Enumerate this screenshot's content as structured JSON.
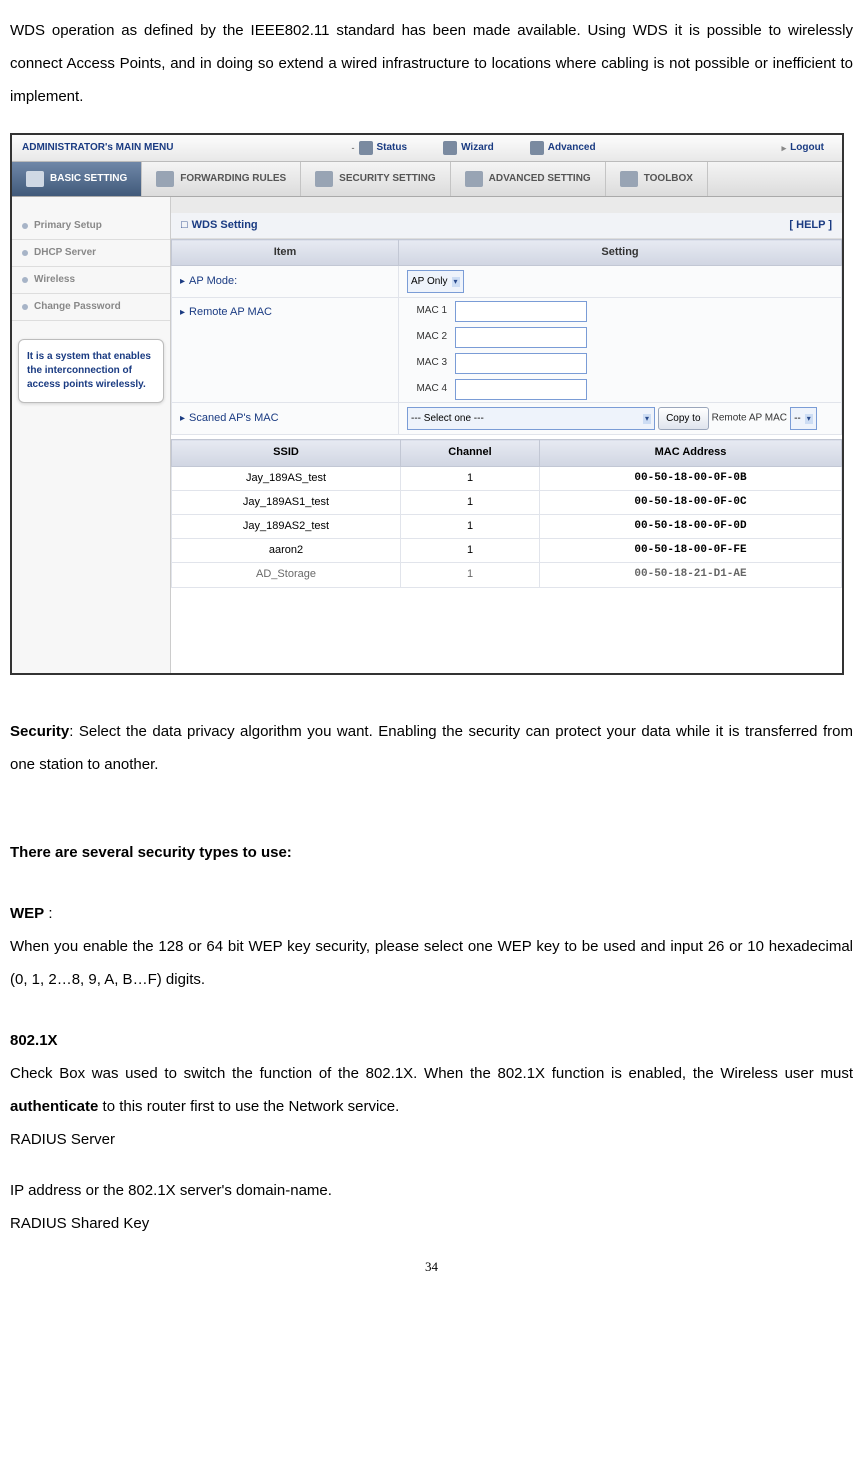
{
  "intro": "WDS operation as defined by the IEEE802.11 standard has been made available. Using WDS it is possible to wirelessly connect Access Points, and in doing so extend a wired infrastructure to locations where cabling is not possible or inefficient to implement.",
  "topbar": {
    "main": "ADMINISTRATOR's MAIN MENU",
    "items": [
      "Status",
      "Wizard",
      "Advanced",
      "Logout"
    ]
  },
  "navbar": {
    "items": [
      "BASIC SETTING",
      "FORWARDING RULES",
      "SECURITY SETTING",
      "ADVANCED SETTING",
      "TOOLBOX"
    ]
  },
  "sidebar": {
    "items": [
      "Primary Setup",
      "DHCP Server",
      "Wireless",
      "Change Password"
    ],
    "tip": "It is a system that enables the interconnection of access points wirelessly."
  },
  "panel": {
    "title": "WDS Setting",
    "help": "[ HELP ]",
    "headers": {
      "item": "Item",
      "setting": "Setting"
    },
    "rows": {
      "ap_mode_label": "AP Mode:",
      "ap_mode_value": "AP Only",
      "remote_ap_label": "Remote AP MAC",
      "mac_labels": [
        "MAC 1",
        "MAC 2",
        "MAC 3",
        "MAC 4"
      ],
      "scanned_label": "Scaned AP's MAC",
      "scanned_select": "--- Select one ---",
      "copy_btn": "Copy to",
      "remote_ap_mac_label": "Remote AP MAC",
      "remote_ap_mac_sel": "--"
    },
    "list_headers": {
      "ssid": "SSID",
      "channel": "Channel",
      "mac": "MAC Address"
    },
    "list": [
      {
        "ssid": "Jay_189AS_test",
        "channel": "1",
        "mac": "00-50-18-00-0F-0B"
      },
      {
        "ssid": "Jay_189AS1_test",
        "channel": "1",
        "mac": "00-50-18-00-0F-0C"
      },
      {
        "ssid": "Jay_189AS2_test",
        "channel": "1",
        "mac": "00-50-18-00-0F-0D"
      },
      {
        "ssid": "aaron2",
        "channel": "1",
        "mac": "00-50-18-00-0F-FE"
      },
      {
        "ssid": "AD_Storage",
        "channel": "1",
        "mac": "00-50-18-21-D1-AE"
      }
    ]
  },
  "doc": {
    "security_label": "Security",
    "security_text": ": Select the data privacy algorithm you want. Enabling the security can protect your data while it is transferred from one station to another.",
    "types_head": "There are several security types to use:",
    "wep_head": "WEP",
    "wep_colon": " :",
    "wep_body": "When you enable the 128 or 64 bit WEP key security, please select one WEP key to be used and input 26 or 10 hexadecimal (0, 1, 2…8, 9, A, B…F) digits.",
    "x_head": "802.1X",
    "x_body_1": "Check Box was used to switch the function of the 802.1X. When the 802.1X function is enabled, the Wireless user must ",
    "x_body_auth": "authenticate",
    "x_body_2": " to this router first to use the Network service.",
    "radius_server": "RADIUS Server",
    "ip_addr": "IP address or the 802.1X server's domain-name.",
    "radius_key": "RADIUS Shared Key",
    "page_num": "34"
  }
}
